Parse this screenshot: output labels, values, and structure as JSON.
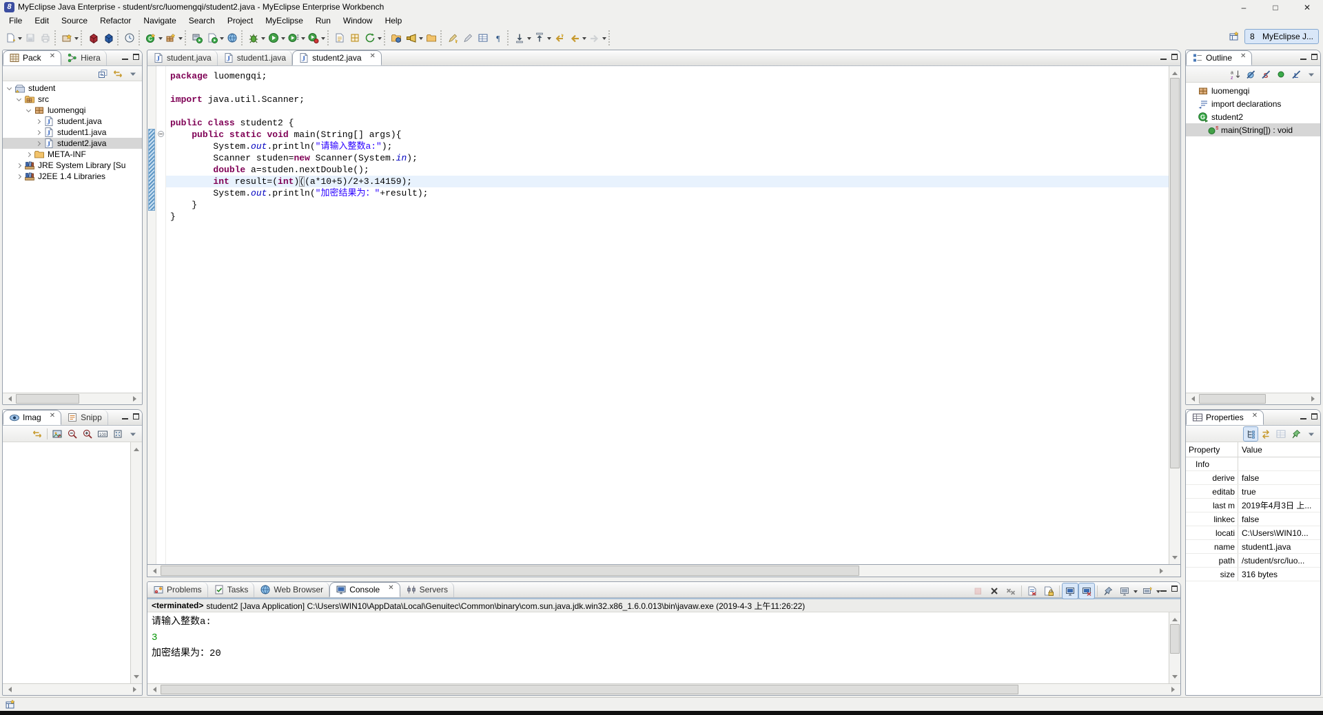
{
  "window": {
    "title": "MyEclipse Java Enterprise - student/src/luomengqi/student2.java - MyEclipse Enterprise Workbench",
    "controls": {
      "minimize": "–",
      "maximize": "□",
      "close": "✕"
    }
  },
  "menu": {
    "items": [
      "File",
      "Edit",
      "Source",
      "Refactor",
      "Navigate",
      "Search",
      "Project",
      "MyEclipse",
      "Run",
      "Window",
      "Help"
    ]
  },
  "toolbar": {
    "groups": [
      {
        "icons": [
          {
            "name": "new-wizard-button",
            "glyph": "page-new",
            "dd": true
          },
          {
            "name": "save-button",
            "glyph": "save",
            "disabled": true
          },
          {
            "name": "print-button",
            "glyph": "print",
            "disabled": true
          }
        ]
      },
      {
        "icons": [
          {
            "name": "new-web-project-button",
            "glyph": "wiz-project",
            "dd": true
          }
        ]
      },
      {
        "icons": [
          {
            "name": "deploy-module-button",
            "glyph": "cube-red"
          },
          {
            "name": "package-module-button",
            "glyph": "cube-blue"
          }
        ]
      },
      {
        "icons": [
          {
            "name": "web-browser-button",
            "glyph": "clock"
          }
        ]
      },
      {
        "icons": [
          {
            "name": "new-java-class-button",
            "glyph": "class-new",
            "dd": true
          },
          {
            "name": "new-java-package-button",
            "glyph": "package-new",
            "dd": true
          }
        ]
      },
      {
        "icons": [
          {
            "name": "run-on-server-button",
            "glyph": "server-run"
          },
          {
            "name": "run-jsp-button",
            "glyph": "page-run",
            "dd": true
          },
          {
            "name": "open-web-browser-button",
            "glyph": "globe"
          }
        ]
      },
      {
        "icons": [
          {
            "name": "debug-button",
            "glyph": "bug",
            "dd": true
          },
          {
            "name": "run-button",
            "glyph": "play",
            "dd": true
          },
          {
            "name": "run-last-button",
            "glyph": "play-list",
            "dd": true
          },
          {
            "name": "profile-button",
            "glyph": "play-red",
            "dd": true
          }
        ]
      },
      {
        "icons": [
          {
            "name": "new-jsp-button",
            "glyph": "page-gold"
          },
          {
            "name": "new-table-button",
            "glyph": "grid-gold"
          },
          {
            "name": "refresh-button",
            "glyph": "refresh",
            "dd": true
          }
        ]
      },
      {
        "icons": [
          {
            "name": "open-type-button",
            "glyph": "folder-ball"
          },
          {
            "name": "search-button",
            "glyph": "flashlight",
            "dd": true
          },
          {
            "name": "open-resource-button",
            "glyph": "folder"
          }
        ]
      },
      {
        "icons": [
          {
            "name": "mark-occurrences-button",
            "glyph": "pencil-gold"
          },
          {
            "name": "edit-annotation-button",
            "glyph": "pencil"
          },
          {
            "name": "show-elements-button",
            "glyph": "table"
          },
          {
            "name": "show-whitespace-button",
            "glyph": "pilcrow"
          }
        ]
      },
      {
        "icons": [
          {
            "name": "next-annotation-button",
            "glyph": "down-arrow",
            "dd": true
          },
          {
            "name": "previous-annotation-button",
            "glyph": "up-arrow",
            "dd": true
          },
          {
            "name": "last-edit-location-button",
            "glyph": "back-star"
          },
          {
            "name": "back-button",
            "glyph": "back",
            "dd": true
          },
          {
            "name": "forward-button",
            "glyph": "forward",
            "dd": true,
            "disabled": true
          }
        ]
      }
    ]
  },
  "perspective_bar": {
    "active_label": "MyEclipse J..."
  },
  "package_explorer": {
    "tabs": [
      {
        "label": "Pack",
        "icon": "pack-tab",
        "active": true,
        "closable": true
      },
      {
        "label": "Hiera",
        "icon": "hiera"
      }
    ],
    "toolbar": [
      {
        "name": "collapse-all-button",
        "glyph": "collapse-all"
      },
      {
        "name": "link-with-editor-button",
        "glyph": "link"
      },
      {
        "name": "view-menu-button",
        "glyph": "menu-tri"
      }
    ],
    "tree": [
      {
        "label": "student",
        "icon": "project",
        "depth": 0,
        "state": "expanded"
      },
      {
        "label": "src",
        "icon": "srcfolder",
        "depth": 1,
        "state": "expanded"
      },
      {
        "label": "luomengqi",
        "icon": "package",
        "depth": 2,
        "state": "expanded"
      },
      {
        "label": "student.java",
        "icon": "jfile",
        "depth": 3,
        "state": "collapsed"
      },
      {
        "label": "student1.java",
        "icon": "jfile",
        "depth": 3,
        "state": "collapsed"
      },
      {
        "label": "student2.java",
        "icon": "jfile",
        "depth": 3,
        "state": "collapsed",
        "selected": true
      },
      {
        "label": "META-INF",
        "icon": "folder",
        "depth": 2,
        "state": "collapsed"
      },
      {
        "label": "JRE System Library [Su",
        "icon": "library",
        "depth": 1,
        "state": "collapsed"
      },
      {
        "label": "J2EE 1.4 Libraries",
        "icon": "library",
        "depth": 1,
        "state": "collapsed"
      }
    ]
  },
  "image_panel": {
    "tabs": [
      {
        "label": "Imag",
        "icon": "eye",
        "active": true,
        "closable": true
      },
      {
        "label": "Snipp",
        "icon": "snippet"
      }
    ],
    "toolbar": [
      {
        "name": "link-with-editor-button",
        "glyph": "link"
      },
      {
        "sep": true
      },
      {
        "name": "image-mode-button",
        "glyph": "image"
      },
      {
        "name": "zoom-out-button",
        "glyph": "zoom-out"
      },
      {
        "name": "zoom-in-button",
        "glyph": "zoom-in"
      },
      {
        "name": "actual-size-button",
        "glyph": "act-100"
      },
      {
        "name": "fit-to-window-button",
        "glyph": "fit"
      },
      {
        "name": "view-menu-button",
        "glyph": "menu-tri"
      }
    ]
  },
  "editor": {
    "tabs": [
      {
        "label": "student.java"
      },
      {
        "label": "student1.java"
      },
      {
        "label": "student2.java",
        "active": true,
        "closable": true
      }
    ],
    "code": [
      {
        "segs": [
          [
            "k",
            "package"
          ],
          [
            "p",
            " luomengqi;"
          ]
        ]
      },
      {
        "segs": []
      },
      {
        "segs": [
          [
            "k",
            "import"
          ],
          [
            "p",
            " java.util.Scanner;"
          ]
        ]
      },
      {
        "segs": []
      },
      {
        "segs": [
          [
            "k",
            "public"
          ],
          [
            "p",
            " "
          ],
          [
            "k",
            "class"
          ],
          [
            "p",
            " student2 {"
          ]
        ]
      },
      {
        "fold": true,
        "segs": [
          [
            "p",
            "    "
          ],
          [
            "k",
            "public"
          ],
          [
            "p",
            " "
          ],
          [
            "k",
            "static"
          ],
          [
            "p",
            " "
          ],
          [
            "k",
            "void"
          ],
          [
            "p",
            " main(String[] args){"
          ]
        ]
      },
      {
        "segs": [
          [
            "p",
            "        System."
          ],
          [
            "f",
            "out"
          ],
          [
            "p",
            ".println("
          ],
          [
            "s",
            "\"请输入整数a:\""
          ],
          [
            "p",
            ");"
          ]
        ]
      },
      {
        "segs": [
          [
            "p",
            "        Scanner studen="
          ],
          [
            "k",
            "new"
          ],
          [
            "p",
            " Scanner(System."
          ],
          [
            "f",
            "in"
          ],
          [
            "p",
            ");"
          ]
        ]
      },
      {
        "segs": [
          [
            "p",
            "        "
          ],
          [
            "k",
            "double"
          ],
          [
            "p",
            " a=studen.nextDouble();"
          ]
        ]
      },
      {
        "current": true,
        "segs": [
          [
            "p",
            "        "
          ],
          [
            "k",
            "int"
          ],
          [
            "p",
            " result=("
          ],
          [
            "k",
            "int"
          ],
          [
            "p",
            ")"
          ],
          [
            "b",
            "("
          ],
          [
            "p",
            "(a*10+5)/2+3.14159);"
          ]
        ]
      },
      {
        "segs": [
          [
            "p",
            "        System."
          ],
          [
            "f",
            "out"
          ],
          [
            "p",
            ".println("
          ],
          [
            "s",
            "\"加密结果为：\""
          ],
          [
            "p",
            "+result);"
          ]
        ]
      },
      {
        "segs": [
          [
            "p",
            "    }"
          ]
        ]
      },
      {
        "segs": [
          [
            "p",
            "}"
          ]
        ]
      }
    ],
    "range_start_line": 6,
    "range_end_line": 12
  },
  "outline": {
    "tabs": [
      {
        "label": "Outline",
        "icon": "outline-tab",
        "active": true,
        "closable": true
      }
    ],
    "toolbar": [
      {
        "name": "sort-button",
        "glyph": "sort-az"
      },
      {
        "name": "hide-fields-button",
        "glyph": "slash-circle"
      },
      {
        "name": "hide-static-members-button",
        "glyph": "slash-s"
      },
      {
        "name": "hide-non-public-members-button",
        "glyph": "green-dot"
      },
      {
        "name": "hide-local-types-button",
        "glyph": "slash-l"
      },
      {
        "name": "view-menu-button",
        "glyph": "menu-tri"
      }
    ],
    "tree": [
      {
        "label": "luomengqi",
        "icon": "package",
        "depth": 0,
        "state": "none"
      },
      {
        "label": "import declarations",
        "icon": "imports",
        "depth": 0,
        "state": "none"
      },
      {
        "label": "student2",
        "icon": "class",
        "depth": 0,
        "state": "none"
      },
      {
        "label": "main(String[]) : void",
        "icon": "method",
        "depth": 1,
        "state": "none",
        "selected": true
      }
    ]
  },
  "properties": {
    "tabs": [
      {
        "label": "Properties",
        "icon": "props-tab",
        "active": true,
        "closable": true
      }
    ],
    "toolbar": [
      {
        "name": "show-categories-button",
        "glyph": "tree-mode",
        "on": true
      },
      {
        "name": "show-advanced-button",
        "glyph": "sort-gold"
      },
      {
        "name": "restore-default-button",
        "glyph": "table",
        "disabled": true
      },
      {
        "name": "pin-to-selection-button",
        "glyph": "pin-green"
      },
      {
        "name": "view-menu-button",
        "glyph": "menu-tri"
      }
    ],
    "columns": {
      "property": "Property",
      "value": "Value"
    },
    "rows": [
      {
        "property": "Info",
        "value": "",
        "category": true
      },
      {
        "property": "derive",
        "value": "false"
      },
      {
        "property": "editab",
        "value": "true"
      },
      {
        "property": "last m",
        "value": "2019年4月3日 上..."
      },
      {
        "property": "linkec",
        "value": "false"
      },
      {
        "property": "locati",
        "value": "C:\\Users\\WIN10..."
      },
      {
        "property": "name",
        "value": "student1.java"
      },
      {
        "property": "path",
        "value": "/student/src/luo..."
      },
      {
        "property": "size",
        "value": "316  bytes"
      }
    ]
  },
  "console": {
    "tabs": [
      {
        "label": "Problems",
        "icon": "problems"
      },
      {
        "label": "Tasks",
        "icon": "tasks"
      },
      {
        "label": "Web Browser",
        "icon": "browser"
      },
      {
        "label": "Console",
        "icon": "console-tab",
        "active": true,
        "closable": true
      },
      {
        "label": "Servers",
        "icon": "servers"
      }
    ],
    "toolbar": [
      {
        "name": "terminate-button",
        "glyph": "terminate",
        "disabled": true
      },
      {
        "name": "remove-launch-button",
        "glyph": "rm-x"
      },
      {
        "name": "remove-all-launches-button",
        "glyph": "rm-xx"
      },
      {
        "sep": true
      },
      {
        "name": "clear-console-button",
        "glyph": "clear-console"
      },
      {
        "name": "scroll-lock-button",
        "glyph": "scroll-lock"
      },
      {
        "sep": true
      },
      {
        "name": "show-stdout-button",
        "glyph": "mon-blue",
        "on": true
      },
      {
        "name": "show-stderr-button",
        "glyph": "mon-x",
        "on": true
      },
      {
        "sep": true
      },
      {
        "name": "pin-console-button",
        "glyph": "pin"
      },
      {
        "name": "display-console-button",
        "glyph": "mon-gray",
        "dd": true
      },
      {
        "name": "open-console-button",
        "glyph": "mon-new",
        "dd": true
      }
    ],
    "header_prefix": "<terminated>",
    "header_rest": " student2 [Java Application] C:\\Users\\WIN10\\AppData\\Local\\Genuitec\\Common\\binary\\com.sun.java.jdk.win32.x86_1.6.0.013\\bin\\javaw.exe (2019-4-3 上午11:26:22)",
    "output": [
      {
        "text": "请输入整数a:",
        "type": "stdout"
      },
      {
        "text": "3",
        "type": "stdin"
      },
      {
        "text": "加密结果为：20",
        "type": "stdout"
      }
    ]
  }
}
